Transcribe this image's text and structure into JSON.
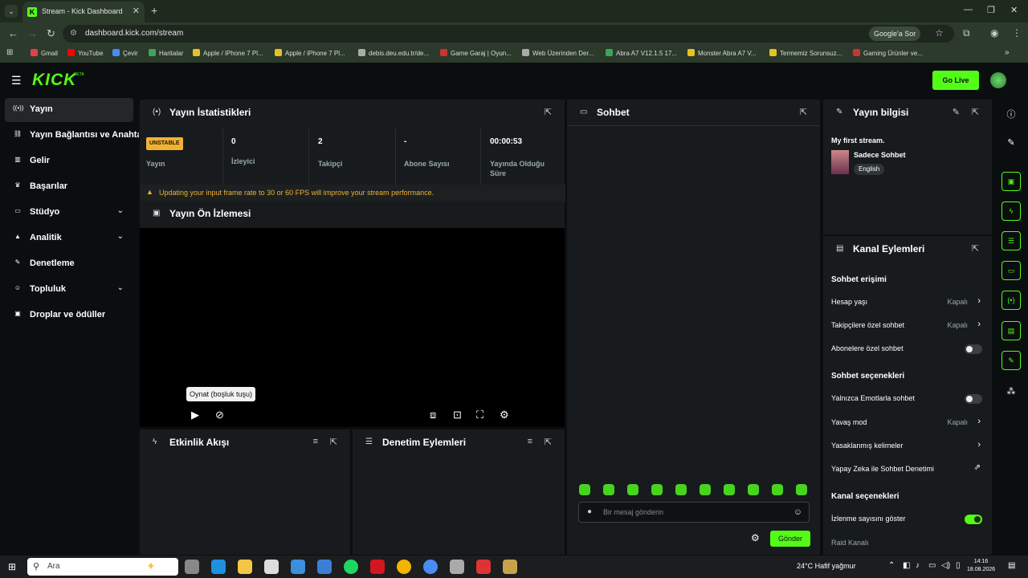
{
  "browser": {
    "tab_title": "Stream - Kick Dashboard",
    "url": "dashboard.kick.com/stream",
    "google_btn": "Google'a Sor",
    "bookmarks": [
      "Gmail",
      "YouTube",
      "Çevir",
      "Haritalar",
      "Apple / iPhone 7 Pl...",
      "Apple / iPhone 7 Pl...",
      "debis.deu.edu.tr/de...",
      "Game Garaj | Oyun...",
      "Web Üzerinden Der...",
      "Abra A7 V12.1.5 17...",
      "Monster Abra A7 V...",
      "Termemiz Sorunsuz...",
      "Gaming Ürünler ve..."
    ],
    "bookmark_colors": [
      "#d44",
      "#f00",
      "#4a8cf5",
      "#3ba55c",
      "#e6c323",
      "#e6c323",
      "#aaa",
      "#c33",
      "#aaa",
      "#3ba55c",
      "#e6c323",
      "#e6c323",
      "#c33"
    ]
  },
  "kick": {
    "logo": "KICK",
    "beta": "BETA",
    "go_live": "Go Live"
  },
  "sidebar": {
    "items": [
      {
        "label": "Yayın",
        "icon": "broadcast-icon",
        "glyph": "((•))"
      },
      {
        "label": "Yayın Bağlantısı ve Anahtarı",
        "icon": "link-icon",
        "glyph": "⛓"
      },
      {
        "label": "Gelir",
        "icon": "chart-icon",
        "glyph": "▥"
      },
      {
        "label": "Başarılar",
        "icon": "trophy-icon",
        "glyph": "♛"
      },
      {
        "label": "Stüdyo",
        "icon": "studio-icon",
        "glyph": "▭"
      },
      {
        "label": "Analitik",
        "icon": "analytics-icon",
        "glyph": "▲"
      },
      {
        "label": "Denetleme",
        "icon": "wrench-icon",
        "glyph": "✎"
      },
      {
        "label": "Topluluk",
        "icon": "community-icon",
        "glyph": "☺"
      },
      {
        "label": "Droplar ve ödüller",
        "icon": "gift-icon",
        "glyph": "▣"
      }
    ]
  },
  "stats": {
    "title": "Yayın İstatistikleri",
    "status_badge": "UNSTABLE",
    "status_label": "Yayın",
    "viewers_value": "0",
    "viewers_label": "İzleyici",
    "followers_value": "2",
    "followers_label": "Takipçi",
    "subs_value": "-",
    "subs_label": "Abone Sayısı",
    "uptime_value": "00:00:53",
    "uptime_label_1": "Yayında Olduğu",
    "uptime_label_2": "Süre",
    "warning": "Updating your input frame rate to 30 or 60 FPS will improve your stream performance."
  },
  "preview": {
    "title": "Yayın Ön İzlemesi",
    "tooltip": "Oynat (boşluk tuşu)"
  },
  "activity": {
    "title": "Etkinlik Akışı"
  },
  "modactions": {
    "title": "Denetim Eylemleri"
  },
  "chat": {
    "title": "Sohbet",
    "placeholder": "Bir mesaj gönderin",
    "send": "Gönder"
  },
  "streaminfo": {
    "title": "Yayın bilgisi",
    "stream_title": "My first stream.",
    "category": "Sadece Sohbet",
    "language": "English"
  },
  "channel_actions": {
    "title": "Kanal Eylemleri",
    "chat_access": "Sohbet erişimi",
    "account_age": "Hesap yaşı",
    "account_age_value": "Kapalı",
    "followers_only": "Takipçilere özel sohbet",
    "followers_only_value": "Kapalı",
    "subs_only": "Abonelere özel sohbet",
    "chat_options": "Sohbet seçenekleri",
    "emotes_only": "Yalnızca Emotlarla sohbet",
    "slow_mode": "Yavaş mod",
    "slow_mode_value": "Kapalı",
    "banned_words": "Yasaklanmış kelimeler",
    "ai_moderation": "Yapay Zeka ile Sohbet Denetimi",
    "channel_options": "Kanal seçenekleri",
    "show_viewers": "İzlenme sayısını göster",
    "raid": "Raid Kanalı"
  },
  "taskbar": {
    "search": "Ara",
    "weather": "24°C  Hafif yağmur",
    "time": "14:16",
    "date": "18.08.2026"
  }
}
